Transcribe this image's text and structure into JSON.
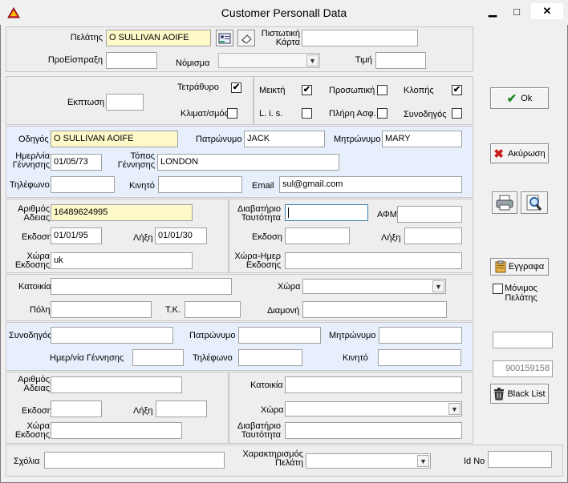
{
  "window": {
    "title": "Customer Personall Data",
    "minimize": "▁",
    "maximize": "□",
    "close": "✕"
  },
  "customer": {
    "label": "Πελάτης",
    "value": "O SULLIVAN AOIFE",
    "credit_card_label_1": "Πιστωτική",
    "credit_card_label_2": "Κάρτα",
    "credit_card_value": "",
    "advance_label": "ΠροΕίσπραξη",
    "advance_value": "",
    "currency_label": "Νόμισμα",
    "currency_value": "",
    "price_label": "Τιμή",
    "price_value": ""
  },
  "options": {
    "discount_label": "Εκπτωση",
    "discount_value": "",
    "four_wheel_label": "Τετράθυρο",
    "four_wheel": true,
    "ac_label": "Κλιματ/σμός",
    "ac": false,
    "mixed_label": "Μεικτή",
    "mixed": true,
    "lis_label": "L. i. s.",
    "lis": false,
    "personal_label": "Προσωπική",
    "personal": false,
    "full_ins_label": "Πλήρη Ασφ.",
    "full_ins": false,
    "theft_label": "Κλοπής",
    "theft": true,
    "driver_label": "Συνοδηγός",
    "driver": false
  },
  "driver": {
    "name_label": "Οδηγός",
    "name": "O SULLIVAN AOIFE",
    "father_label": "Πατρώνυμο",
    "father": "JACK",
    "mother_label": "Μητρώνυμο",
    "mother": "MARY",
    "birth_label_1": "Ημερ/νία",
    "birth_label_2": "Γέννησης",
    "birth": "01/05/73",
    "place_label_1": "Τόπος",
    "place_label_2": "Γέννησης",
    "place": "LONDON",
    "phone_label": "Τηλέφωνο",
    "phone": "",
    "mobile_label": "Κινητό",
    "mobile": "",
    "email_label": "Email",
    "email": "sul@gmail.com"
  },
  "license": {
    "number_label_1": "Αριθμός",
    "number_label_2": "Αδειας",
    "number": "16489624995",
    "issue_label": "Εκδοση",
    "issue": "01/01/95",
    "expiry_label": "Λήξη",
    "expiry": "01/01/30",
    "country_label_1": "Χώρα",
    "country_label_2": "Εκδοσης",
    "country": "uk",
    "passport_label_1": "Διαβατήριο",
    "passport_label_2": "Ταυτότητα",
    "passport": "",
    "afm_label": "ΑΦΜ",
    "afm": "",
    "pass_issue_label": "Εκδοση",
    "pass_issue": "",
    "pass_expiry_label": "Λήξη",
    "pass_expiry": "",
    "pass_country_label_1": "Χώρα-Ημερ",
    "pass_country_label_2": "Εκδοσης",
    "pass_country": ""
  },
  "address": {
    "residence_label": "Κατοικία",
    "residence": "",
    "country_label": "Χώρα",
    "country": "",
    "city_label": "Πόλη",
    "city": "",
    "zip_label": "Τ.Κ.",
    "zip": "",
    "stay_label": "Διαμονή",
    "stay": ""
  },
  "codriver": {
    "name_label": "Συνοδηγός",
    "name": "",
    "father_label": "Πατρώνυμο",
    "father": "",
    "mother_label": "Μητρώνυμο",
    "mother": "",
    "birth_label": "Ημερ/νία Γέννησης",
    "birth": "",
    "phone_label": "Τηλέφωνο",
    "phone": "",
    "mobile_label": "Κινητό",
    "mobile": ""
  },
  "codriver_license": {
    "number_label_1": "Αριθμός",
    "number_label_2": "Αδειας",
    "number": "",
    "issue_label": "Εκδοση",
    "issue": "",
    "expiry_label": "Λήξη",
    "expiry": "",
    "country_label_1": "Χώρα",
    "country_label_2": "Εκδοσης",
    "country": "",
    "residence_label": "Κατοικία",
    "residence": "",
    "cc_label": "Χώρα",
    "cc": "",
    "passport_label_1": "Διαβατήριο",
    "passport_label_2": "Ταυτότητα",
    "passport": ""
  },
  "footer": {
    "comments_label": "Σχόλια",
    "comments": "",
    "char_label_1": "Χαρακτηρισμός",
    "char_label_2": "Πελάτη",
    "char_value": "",
    "id_label": "Id No",
    "id_value": ""
  },
  "side": {
    "ok": "Ok",
    "cancel": "Ακύρωση",
    "documents": "Εγγραφα",
    "permanent_label_1": "Μόνιμος",
    "permanent_label_2": "Πελάτης",
    "permanent": false,
    "field1": "",
    "field2": "900159158",
    "blacklist": "Black List"
  }
}
